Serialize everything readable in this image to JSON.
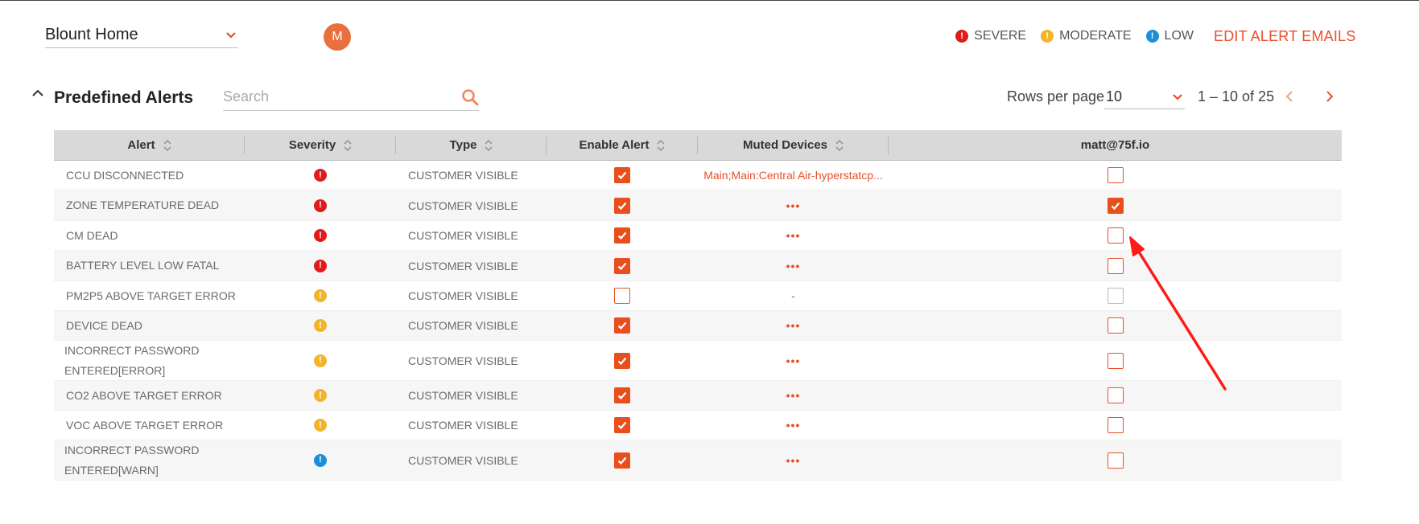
{
  "site_selector": {
    "value": "Blount Home"
  },
  "user_avatar": {
    "initial": "M"
  },
  "legend": {
    "severe": "SEVERE",
    "moderate": "MODERATE",
    "low": "LOW"
  },
  "edit_alert_emails": "EDIT ALERT EMAILS",
  "section": {
    "title": "Predefined Alerts"
  },
  "search": {
    "placeholder": "Search",
    "value": ""
  },
  "pagination": {
    "rows_label": "Rows per page",
    "rows_value": "10",
    "range": "1 – 10 of 25"
  },
  "table": {
    "headers": {
      "alert": "Alert",
      "severity": "Severity",
      "type": "Type",
      "enable": "Enable Alert",
      "muted": "Muted Devices",
      "email": "matt@75f.io"
    },
    "rows": [
      {
        "alert": "CCU DISCONNECTED",
        "severity": "severe",
        "type": "CUSTOMER VISIBLE",
        "enabled": true,
        "muted": "Main;Main:Central Air-hyperstatcp...",
        "email": false
      },
      {
        "alert": "ZONE TEMPERATURE DEAD",
        "severity": "severe",
        "type": "CUSTOMER VISIBLE",
        "enabled": true,
        "muted": "•••",
        "email": true
      },
      {
        "alert": "CM DEAD",
        "severity": "severe",
        "type": "CUSTOMER VISIBLE",
        "enabled": true,
        "muted": "•••",
        "email": false
      },
      {
        "alert": "BATTERY LEVEL LOW FATAL",
        "severity": "severe",
        "type": "CUSTOMER VISIBLE",
        "enabled": true,
        "muted": "•••",
        "email": false
      },
      {
        "alert": "PM2P5 ABOVE TARGET ERROR",
        "severity": "moderate",
        "type": "CUSTOMER VISIBLE",
        "enabled": false,
        "muted": "-",
        "email": false,
        "email_disabled": true
      },
      {
        "alert": "DEVICE DEAD",
        "severity": "moderate",
        "type": "CUSTOMER VISIBLE",
        "enabled": true,
        "muted": "•••",
        "email": false
      },
      {
        "alert": "INCORRECT PASSWORD ENTERED[ERROR]",
        "alert_line1": "INCORRECT PASSWORD",
        "alert_line2": "ENTERED[ERROR]",
        "severity": "moderate",
        "type": "CUSTOMER VISIBLE",
        "enabled": true,
        "muted": "•••",
        "email": false
      },
      {
        "alert": "CO2 ABOVE TARGET ERROR",
        "severity": "moderate",
        "type": "CUSTOMER VISIBLE",
        "enabled": true,
        "muted": "•••",
        "email": false
      },
      {
        "alert": "VOC ABOVE TARGET ERROR",
        "severity": "moderate",
        "type": "CUSTOMER VISIBLE",
        "enabled": true,
        "muted": "•••",
        "email": false
      },
      {
        "alert": "INCORRECT PASSWORD ENTERED[WARN]",
        "alert_line1": "INCORRECT PASSWORD",
        "alert_line2": "ENTERED[WARN]",
        "severity": "low",
        "type": "CUSTOMER VISIBLE",
        "enabled": true,
        "muted": "•••",
        "email": false
      }
    ]
  },
  "colors": {
    "accent": "#e8502a",
    "severe": "#e01b1b",
    "moderate": "#f3b32b",
    "low": "#1a8fd8",
    "annotation_arrow": "#ff1a1a"
  }
}
